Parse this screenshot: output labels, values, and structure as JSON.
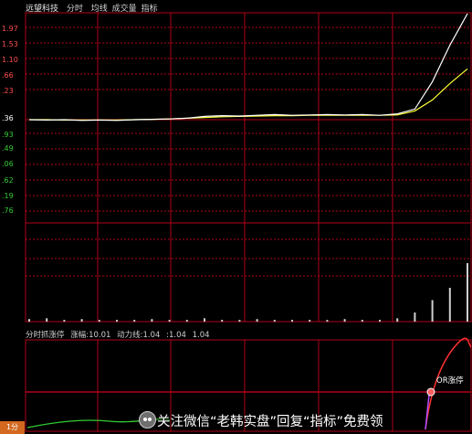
{
  "header": {
    "stock_name": "远望科技",
    "mode": "分时",
    "legend_avg": "均线",
    "legend_volume": "成交量",
    "legend_indicator": "指标"
  },
  "price_axis": {
    "labels": [
      {
        "text": "1.97",
        "color": "#ff4d4d"
      },
      {
        "text": "1.53",
        "color": "#ff4d4d"
      },
      {
        "text": "1.10",
        "color": "#ff4d4d"
      },
      {
        "text": ".66",
        "color": "#ff4d4d"
      },
      {
        "text": ".23",
        "color": "#ff4d4d"
      },
      {
        "text": ".36",
        "color": "#ffffff"
      },
      {
        "text": ".93",
        "color": "#33cc33"
      },
      {
        "text": ".49",
        "color": "#33cc33"
      },
      {
        "text": ".06",
        "color": "#33cc33"
      },
      {
        "text": ".62",
        "color": "#33cc33"
      },
      {
        "text": ".19",
        "color": "#33cc33"
      },
      {
        "text": ".76",
        "color": "#33cc33"
      }
    ]
  },
  "indicator": {
    "name": "分时抓涨停",
    "field1": "涨幅:10.01",
    "field2": "动力线:1.04",
    "field3": ":1.04",
    "field4": "1.04",
    "signal_label": "OR涨停"
  },
  "corner_label": "1分",
  "watermark": {
    "text": "关注微信“老韩实盘”回复“指标”免费领"
  },
  "colors": {
    "grid_red": "#b0001a",
    "price_line": "#ffffff",
    "avg_line": "#ffff33",
    "volume": "#d0d0d0",
    "power_line": "#ff3030",
    "green_line": "#33cc33"
  },
  "chart_data": {
    "type": "line",
    "series": [
      {
        "values": [
          0.36,
          0.35,
          0.36,
          0.34,
          0.35,
          0.34,
          0.36,
          0.37,
          0.38,
          0.4,
          0.45,
          0.47,
          0.46,
          0.48,
          0.5,
          0.48,
          0.49,
          0.5,
          0.49,
          0.5,
          0.48,
          0.52,
          0.65,
          1.4,
          2.4,
          3.3
        ]
      },
      {
        "values": [
          0.36,
          0.36,
          0.35,
          0.35,
          0.35,
          0.35,
          0.36,
          0.37,
          0.38,
          0.4,
          0.42,
          0.44,
          0.45,
          0.46,
          0.47,
          0.47,
          0.48,
          0.48,
          0.48,
          0.48,
          0.48,
          0.49,
          0.6,
          0.9,
          1.35,
          1.75
        ]
      }
    ],
    "volume": [
      2,
      3,
      1,
      2,
      1,
      1,
      1,
      2,
      1,
      1,
      3,
      1,
      1,
      2,
      1,
      1,
      1,
      1,
      2,
      1,
      1,
      3,
      10,
      25,
      40,
      70
    ]
  }
}
